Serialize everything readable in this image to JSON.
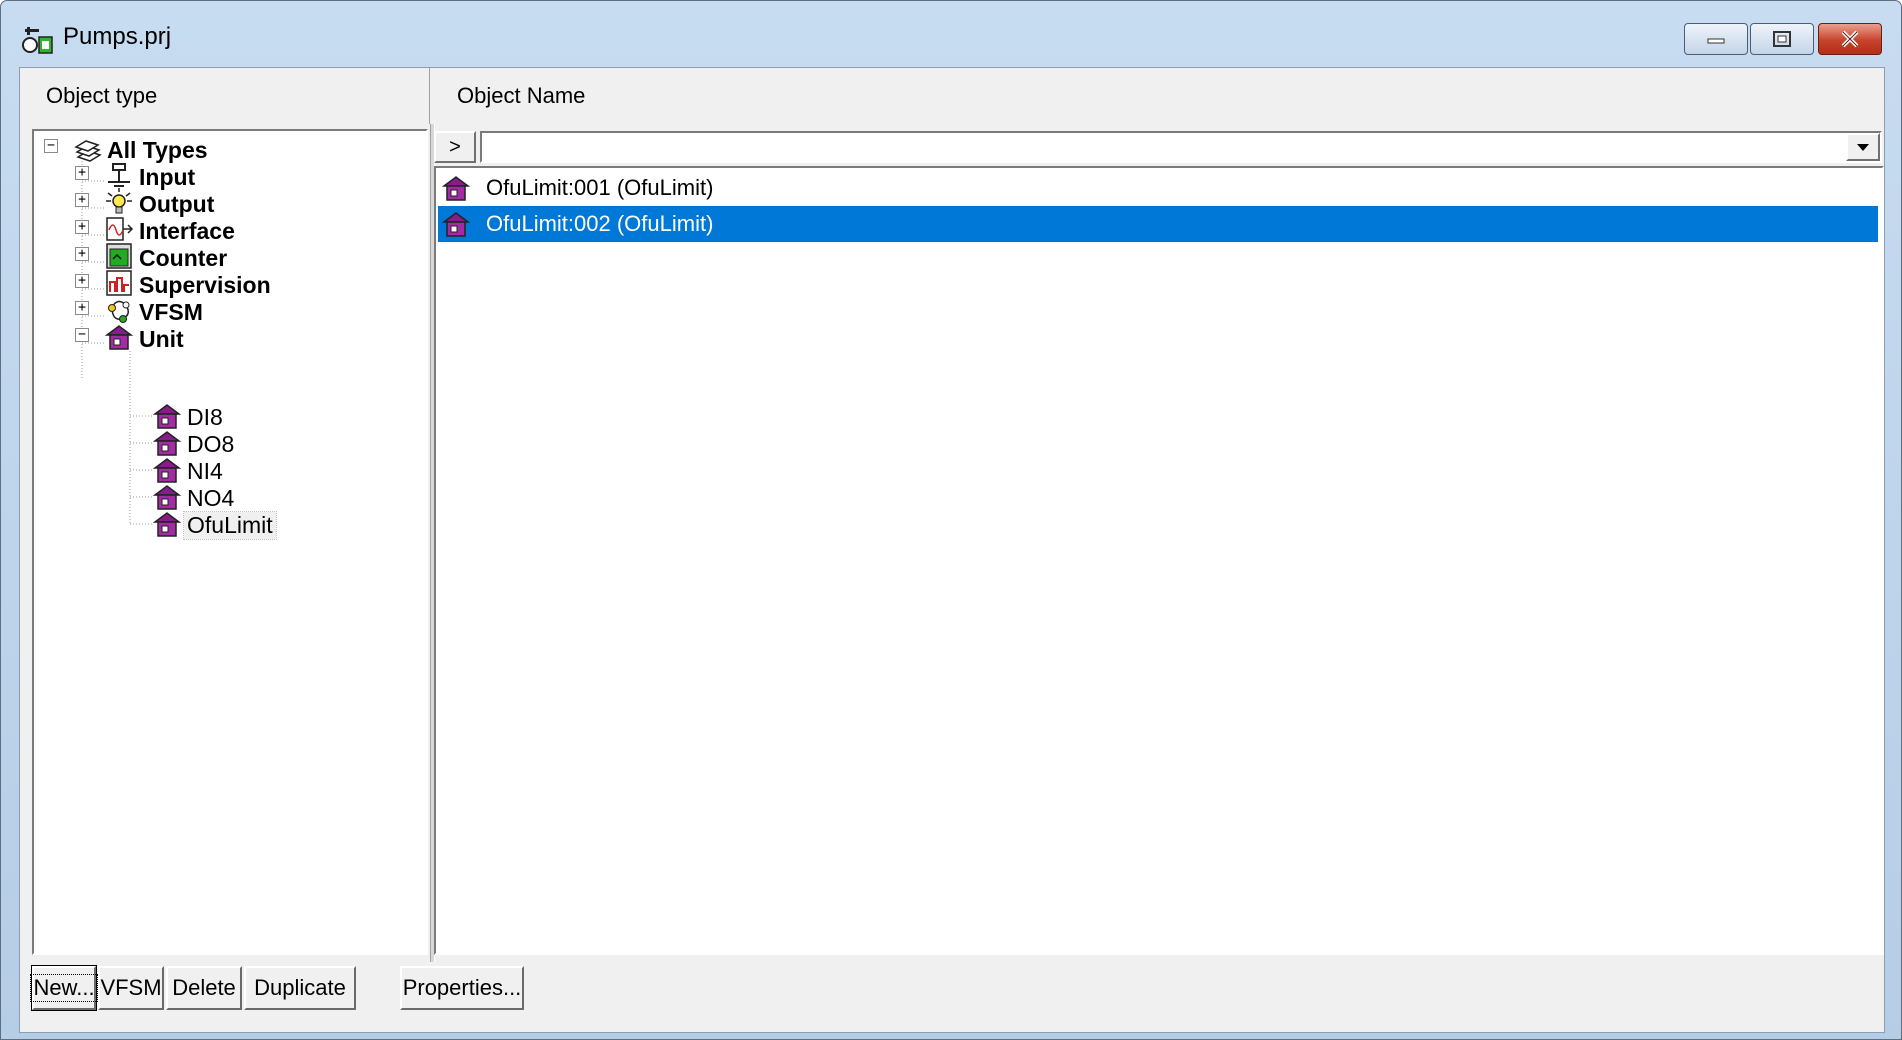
{
  "window": {
    "title": "Pumps.prj",
    "controls": {
      "minimize_icon": "minimize-icon",
      "maximize_icon": "restore-icon",
      "close_icon": "close-icon"
    }
  },
  "headers": {
    "left": "Object type",
    "right": "Object Name"
  },
  "tree": {
    "root": {
      "label": "All Types",
      "icon": "stack-icon",
      "expanded": true
    },
    "groups": [
      {
        "label": "Input",
        "icon": "input-switch-icon",
        "expanded": false
      },
      {
        "label": "Output",
        "icon": "lightbulb-icon",
        "expanded": false
      },
      {
        "label": "Interface",
        "icon": "interface-icon",
        "expanded": false
      },
      {
        "label": "Counter",
        "icon": "counter-icon",
        "expanded": false
      },
      {
        "label": "Supervision",
        "icon": "supervision-icon",
        "expanded": false
      },
      {
        "label": "VFSM",
        "icon": "state-machine-icon",
        "expanded": false
      },
      {
        "label": "Unit",
        "icon": "unit-house-icon",
        "expanded": true
      }
    ],
    "unit_children": [
      "DI8",
      "DO8",
      "NI4",
      "NO4",
      "OfuLimit"
    ],
    "selected_child": "OfuLimit"
  },
  "filter": {
    "go_label": ">",
    "value": ""
  },
  "objects": [
    {
      "label": "OfuLimit:001 (OfuLimit)",
      "selected": false
    },
    {
      "label": "OfuLimit:002 (OfuLimit)",
      "selected": true
    }
  ],
  "buttons": {
    "new": "New...",
    "vfsm": "VFSM",
    "delete": "Delete",
    "duplicate": "Duplicate",
    "properties": "Properties..."
  },
  "colors": {
    "selection": "#0078d7",
    "unit_icon": "#8b1a8b",
    "counter_icon": "#22aa22",
    "supervision_icon": "#cc2222"
  }
}
